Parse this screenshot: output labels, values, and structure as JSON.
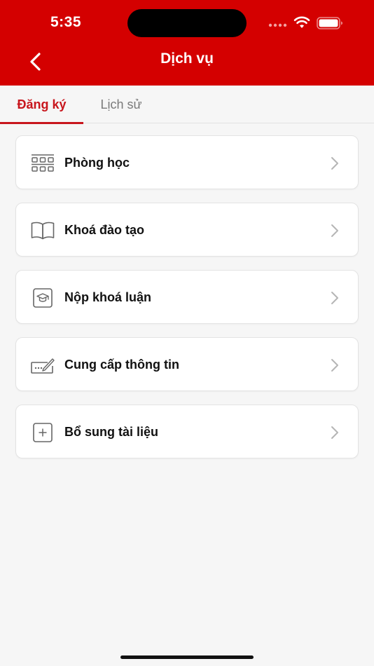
{
  "status_bar": {
    "time": "5:35"
  },
  "header": {
    "title": "Dịch vụ"
  },
  "tabs": [
    {
      "label": "Đăng ký",
      "active": true
    },
    {
      "label": "Lịch sử",
      "active": false
    }
  ],
  "services": [
    {
      "label": "Phòng học",
      "icon": "classroom-grid-icon"
    },
    {
      "label": "Khoá đào tạo",
      "icon": "open-book-icon"
    },
    {
      "label": "Nộp khoá luận",
      "icon": "graduation-cap-icon"
    },
    {
      "label": "Cung cấp thông tin",
      "icon": "signature-pen-icon"
    },
    {
      "label": "Bổ sung tài liệu",
      "icon": "plus-square-icon"
    }
  ],
  "colors": {
    "header_bg": "#d40000",
    "active_tab": "#c8161d",
    "inactive_tab": "#7a7a7a",
    "background": "#f6f6f6"
  }
}
